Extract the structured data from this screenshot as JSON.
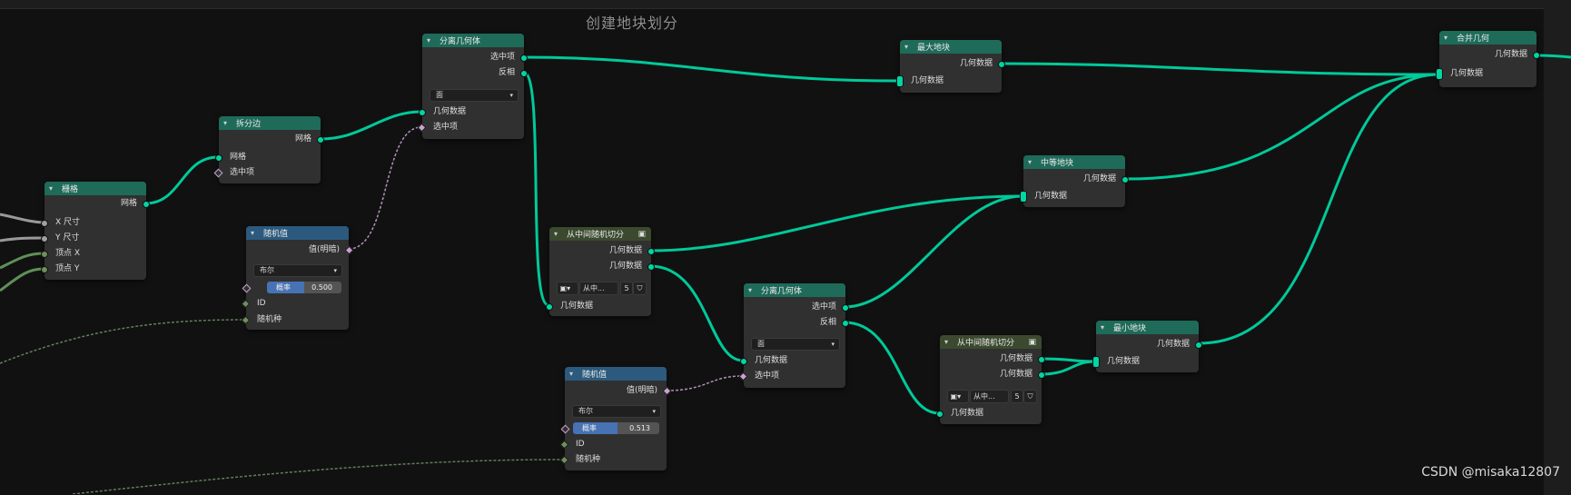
{
  "frame": {
    "title": "创建地块划分"
  },
  "watermark": "CSDN @misaka12807",
  "nodes": {
    "grid": {
      "title": "栅格",
      "out": "网格",
      "in": [
        "X 尺寸",
        "Y 尺寸",
        "顶点 X",
        "顶点 Y"
      ]
    },
    "split_edges": {
      "title": "拆分边",
      "out": "网格",
      "in": [
        "网格",
        "选中项"
      ]
    },
    "random1": {
      "title": "随机值",
      "out": "值(明暗)",
      "type": "布尔",
      "prob_label": "概率",
      "prob_value": "0.500",
      "prob": 0.5,
      "in": [
        "ID",
        "随机种"
      ]
    },
    "separate1": {
      "title": "分离几何体",
      "out_sel": "选中项",
      "out_inv": "反相",
      "domain": "面",
      "in": [
        "几何数据",
        "选中项"
      ]
    },
    "max_block": {
      "title": "最大地块",
      "out": "几何数据",
      "in": "几何数据"
    },
    "split_mid1": {
      "title": "从中间随机切分",
      "out1": "几何数据",
      "out2": "几何数据",
      "group_name": "从中...",
      "users": "5",
      "in": "几何数据"
    },
    "mid_block": {
      "title": "中等地块",
      "out": "几何数据",
      "in": "几何数据"
    },
    "join": {
      "title": "合并几何",
      "out": "几何数据",
      "in": "几何数据"
    },
    "random2": {
      "title": "随机值",
      "out": "值(明暗)",
      "type": "布尔",
      "prob_label": "概率",
      "prob_value": "0.513",
      "prob": 0.513,
      "in": [
        "ID",
        "随机种"
      ]
    },
    "separate2": {
      "title": "分离几何体",
      "out_sel": "选中项",
      "out_inv": "反相",
      "domain": "面",
      "in": [
        "几何数据",
        "选中项"
      ]
    },
    "split_mid2": {
      "title": "从中间随机切分",
      "out1": "几何数据",
      "out2": "几何数据",
      "group_name": "从中...",
      "users": "5",
      "in": "几何数据"
    },
    "min_block": {
      "title": "最小地块",
      "out": "几何数据",
      "in": "几何数据"
    }
  },
  "colors": {
    "geometry_socket": "#00d6a3",
    "boolean_socket": "#c8a2cf",
    "geo_header": "#1e6b5a",
    "func_header": "#2b5a7e",
    "group_header": "#3b4a2f"
  }
}
